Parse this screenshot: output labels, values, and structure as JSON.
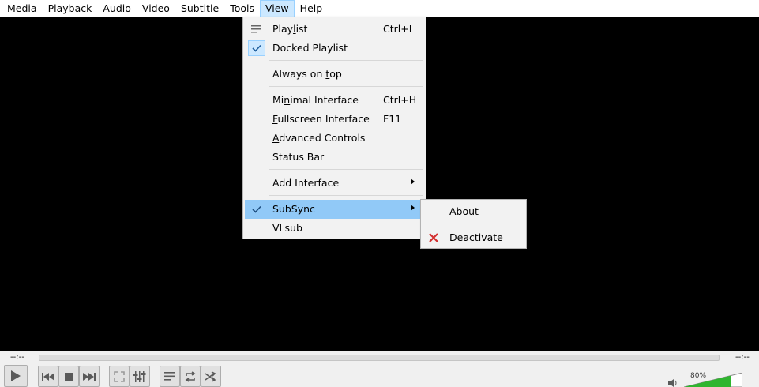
{
  "menubar": {
    "items": [
      {
        "ul": "M",
        "rest": "edia"
      },
      {
        "ul": "P",
        "rest": "layback"
      },
      {
        "ul": "A",
        "rest": "udio"
      },
      {
        "ul": "V",
        "rest": "ideo"
      },
      {
        "pre": "Sub",
        "ul": "t",
        "rest": "itle"
      },
      {
        "pre": "Tool",
        "ul": "s",
        "rest": ""
      },
      {
        "ul": "V",
        "rest": "iew"
      },
      {
        "ul": "H",
        "rest": "elp"
      }
    ]
  },
  "view_menu": {
    "playlist": {
      "pre": "Play",
      "ul": "l",
      "rest": "ist",
      "shortcut": "Ctrl+L",
      "icon": "playlist-icon"
    },
    "docked_playlist": {
      "label": "Docked Playlist",
      "checked": true
    },
    "always_on_top": {
      "pre": "Always on ",
      "ul": "t",
      "rest": "op"
    },
    "minimal_interface": {
      "pre": "Mi",
      "ul": "n",
      "rest": "imal Interface",
      "shortcut": "Ctrl+H"
    },
    "fullscreen_interface": {
      "pre": "",
      "ul": "F",
      "rest": "ullscreen Interface",
      "shortcut": "F11"
    },
    "advanced_controls": {
      "pre": "",
      "ul": "A",
      "rest": "dvanced Controls"
    },
    "status_bar": {
      "label": "Status Bar"
    },
    "add_interface": {
      "label": "Add Interface"
    },
    "subsync": {
      "label": "SubSync",
      "checked": true,
      "highlighted": true
    },
    "vlsub": {
      "label": "VLsub"
    }
  },
  "subsync_menu": {
    "about": "About",
    "deactivate": "Deactivate",
    "deactivate_icon_color": "#d32f2f"
  },
  "player": {
    "time_elapsed": "--:--",
    "time_total": "--:--",
    "volume": "80%",
    "volume_level": 0.8,
    "accent_green": "#2fb52f"
  }
}
